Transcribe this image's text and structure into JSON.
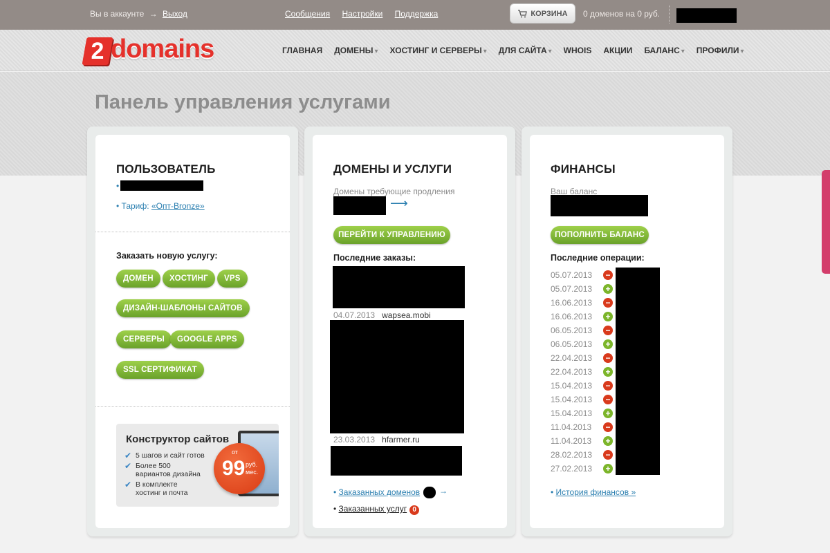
{
  "topbar": {
    "account_text": "Вы в аккаунте",
    "logout": "Выход",
    "links": [
      "Сообщения",
      "Настройки",
      "Поддержка"
    ],
    "cart_label": "КОРЗИНА",
    "cart_info": "0 доменов на 0 руб."
  },
  "header": {
    "logo_digit": "2",
    "logo_word": "domains",
    "nav": [
      {
        "label": "ГЛАВНАЯ"
      },
      {
        "label": "ДОМЕНЫ"
      },
      {
        "label": "ХОСТИНГ И СЕРВЕРЫ"
      },
      {
        "label": "ДЛЯ САЙТА"
      },
      {
        "label": "WHOIS"
      },
      {
        "label": "АКЦИИ"
      },
      {
        "label": "БАЛАНС"
      },
      {
        "label": "ПРОФИЛИ"
      }
    ]
  },
  "page_title": "Панель управления услугами",
  "user_panel": {
    "title": "ПОЛЬЗОВАТЕЛЬ",
    "tariff_label": "Тариф:",
    "tariff_value": "«Опт-Bronze»",
    "order_label": "Заказать новую услугу:",
    "services": [
      "ДОМЕН",
      "ХОСТИНГ",
      "VPS",
      "ДИЗАЙН-ШАБЛОНЫ САЙТОВ",
      "СЕРВЕРЫ",
      "GOOGLE APPS",
      "SSL СЕРТИФИКАТ"
    ],
    "banner": {
      "title": "Конструктор сайтов",
      "items": [
        "5 шагов и сайт готов",
        "Более 500 вариантов дизайна",
        "В комплекте хостинг и почта"
      ],
      "price_from": "от",
      "price": "99",
      "price_unit_1": "руб.",
      "price_unit_2": "мес."
    }
  },
  "domains_panel": {
    "title": "ДОМЕНЫ И УСЛУГИ",
    "renewal_label": "Домены требующие продления",
    "manage_button": "ПЕРЕЙТИ К УПРАВЛЕНИЮ",
    "recent_label": "Последние заказы:",
    "orders": [
      {
        "date": "04.07.2013",
        "name": "wapsea.mobi"
      },
      {
        "date": "23.03.2013",
        "name": "hfarmer.ru"
      }
    ],
    "ordered_domains": "Заказанных доменов",
    "ordered_services": "Заказанных услуг",
    "ordered_services_count": "0"
  },
  "finance_panel": {
    "title": "ФИНАНСЫ",
    "balance_label": "Ваш баланс",
    "topup_button": "ПОПОЛНИТЬ БАЛАНС",
    "ops_label": "Последние операции:",
    "operations": [
      {
        "date": "05.07.2013",
        "type": "minus"
      },
      {
        "date": "05.07.2013",
        "type": "plus"
      },
      {
        "date": "16.06.2013",
        "type": "minus"
      },
      {
        "date": "16.06.2013",
        "type": "plus"
      },
      {
        "date": "06.05.2013",
        "type": "minus"
      },
      {
        "date": "06.05.2013",
        "type": "plus"
      },
      {
        "date": "22.04.2013",
        "type": "minus"
      },
      {
        "date": "22.04.2013",
        "type": "plus"
      },
      {
        "date": "15.04.2013",
        "type": "minus"
      },
      {
        "date": "15.04.2013",
        "type": "minus"
      },
      {
        "date": "15.04.2013",
        "type": "plus"
      },
      {
        "date": "11.04.2013",
        "type": "minus"
      },
      {
        "date": "11.04.2013",
        "type": "plus"
      },
      {
        "date": "28.02.2013",
        "type": "minus"
      },
      {
        "date": "27.02.2013",
        "type": "plus"
      }
    ],
    "history_link": "История финансов »"
  },
  "colors": {
    "topbar": "#938b87",
    "brand_red": "#e5312b",
    "link_blue": "#2b7fb0",
    "button_green": "#7cb52a"
  }
}
